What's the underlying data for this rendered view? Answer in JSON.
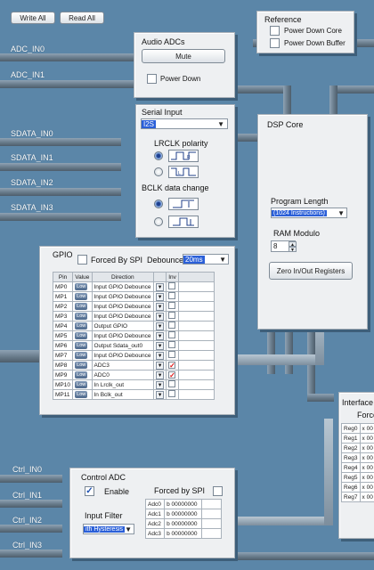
{
  "toolbar": {
    "write_all": "Write All",
    "read_all": "Read All"
  },
  "reference": {
    "title": "Reference",
    "power_down_core": "Power Down Core",
    "power_down_buffer": "Power Down Buffer"
  },
  "adc_inputs": [
    "ADC_IN0",
    "ADC_IN1"
  ],
  "audio_adcs": {
    "title": "Audio ADCs",
    "mute": "Mute",
    "power_down": "Power Down"
  },
  "serial_input": {
    "title": "Serial Input",
    "value": "I2S",
    "lrclk_label": "LRCLK polarity",
    "bclk_label": "BCLK data change"
  },
  "sdata_inputs": [
    "SDATA_IN0",
    "SDATA_IN1",
    "SDATA_IN2",
    "SDATA_IN3"
  ],
  "dsp_core": {
    "title": "DSP Core",
    "program_length_label": "Program Length",
    "program_length_value": "(1024 Instructions)",
    "ram_modulo_label": "RAM Modulo",
    "ram_modulo_value": "8",
    "zero_button": "Zero In/Out Registers"
  },
  "gpio": {
    "title": "GPIO",
    "forced_by_spi": "Forced By SPI",
    "debounce_label": "Debounce",
    "debounce_value": "20ms",
    "headers": [
      "Pin",
      "Value",
      "Direction",
      "Inv"
    ],
    "rows": [
      {
        "pin": "MP0",
        "value": "Low",
        "direction": "Input GPIO Debounce",
        "inv": false
      },
      {
        "pin": "MP1",
        "value": "Low",
        "direction": "Input GPIO Debounce",
        "inv": false
      },
      {
        "pin": "MP2",
        "value": "Low",
        "direction": "Input GPIO Debounce",
        "inv": false
      },
      {
        "pin": "MP3",
        "value": "Low",
        "direction": "Input GPIO Debounce",
        "inv": false
      },
      {
        "pin": "MP4",
        "value": "Low",
        "direction": "Output GPIO",
        "inv": false
      },
      {
        "pin": "MP5",
        "value": "Low",
        "direction": "Input GPIO Debounce",
        "inv": false
      },
      {
        "pin": "MP6",
        "value": "Low",
        "direction": "Output Sdata_out0",
        "inv": false
      },
      {
        "pin": "MP7",
        "value": "Low",
        "direction": "Input GPIO Debounce",
        "inv": false
      },
      {
        "pin": "MP8",
        "value": "Low",
        "direction": "ADC3",
        "inv": true
      },
      {
        "pin": "MP9",
        "value": "Low",
        "direction": "ADC0",
        "inv": true
      },
      {
        "pin": "MP10",
        "value": "Low",
        "direction": "In Lrclk_out",
        "inv": false
      },
      {
        "pin": "MP11",
        "value": "Low",
        "direction": "In Bclk_out",
        "inv": false
      }
    ]
  },
  "interface": {
    "title": "Interface R",
    "force_label": "Force",
    "rows": [
      {
        "reg": "Reg0",
        "val": "x 00"
      },
      {
        "reg": "Reg1",
        "val": "x 00"
      },
      {
        "reg": "Reg2",
        "val": "x 00"
      },
      {
        "reg": "Reg3",
        "val": "x 00"
      },
      {
        "reg": "Reg4",
        "val": "x 00"
      },
      {
        "reg": "Reg5",
        "val": "x 00"
      },
      {
        "reg": "Reg6",
        "val": "x 00"
      },
      {
        "reg": "Reg7",
        "val": "x 00"
      }
    ]
  },
  "ctrl_inputs": [
    "Ctrl_IN0",
    "Ctrl_IN1",
    "Ctrl_IN2",
    "Ctrl_IN3"
  ],
  "control_adc": {
    "title": "Control ADC",
    "enable": "Enable",
    "forced_by_spi": "Forced by SPI",
    "input_filter_label": "Input Filter",
    "input_filter_value": "ith Hysteresis",
    "rows": [
      {
        "name": "Adc0",
        "value": "b 00000000"
      },
      {
        "name": "Adc1",
        "value": "b 00000000"
      },
      {
        "name": "Adc2",
        "value": "b 00000000"
      },
      {
        "name": "Adc3",
        "value": "b 00000000"
      }
    ]
  },
  "colors": {
    "background": "#5b86a8",
    "selection": "#2a5fd8",
    "checkmark_red": "#d11111",
    "panel": "#eef0f2"
  }
}
